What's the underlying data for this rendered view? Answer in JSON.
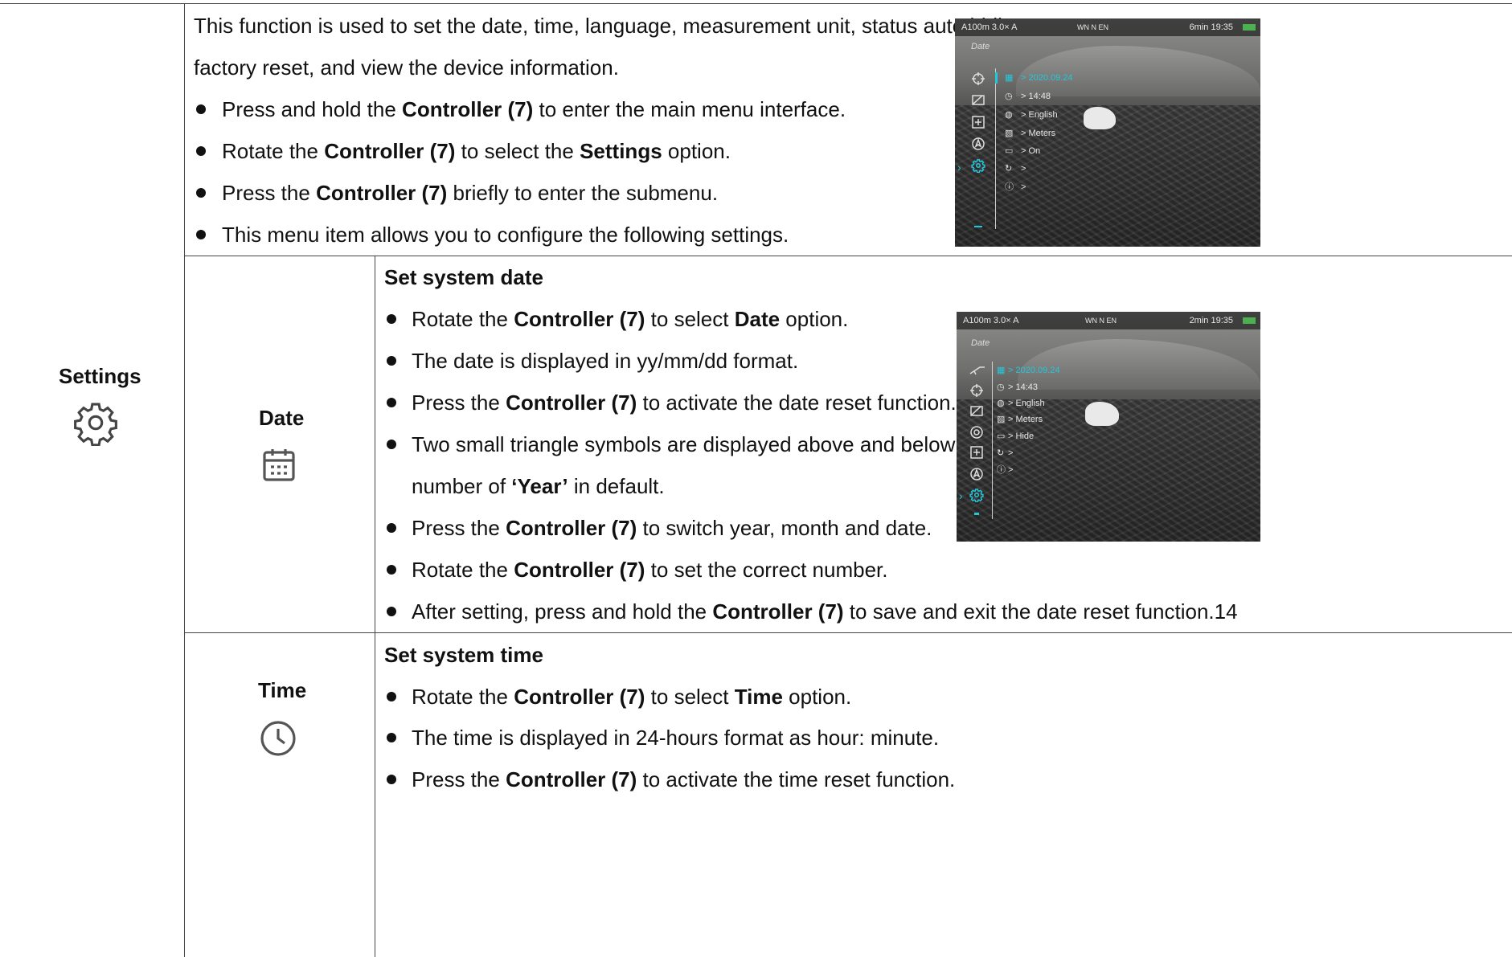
{
  "section": {
    "name": "Settings",
    "icon": "gear-icon",
    "intro": "This function is used to set the date, time, language, measurement unit, status auto hiding,",
    "intro_line2": "factory reset, and view the device information.",
    "steps": [
      {
        "pre": "Press and hold the ",
        "b1": "Controller (7)",
        "mid": " to enter the main menu interface.",
        "b2": "",
        "post": ""
      },
      {
        "pre": "Rotate the ",
        "b1": "Controller (7)",
        "mid": " to select the ",
        "b2": "Settings",
        "post": " option."
      },
      {
        "pre": "Press the ",
        "b1": "Controller (7)",
        "mid": " briefly to enter the submenu.",
        "b2": "",
        "post": ""
      },
      {
        "pre": "This menu item allows you to configure the following settings.",
        "b1": "",
        "mid": "",
        "b2": "",
        "post": ""
      }
    ]
  },
  "date": {
    "name": "Date",
    "icon": "calendar-icon",
    "heading": "Set system date",
    "steps": [
      {
        "pre": "Rotate the ",
        "b1": "Controller (7)",
        "mid": " to select ",
        "b2": "Date",
        "post": " option."
      },
      {
        "pre": "The date is displayed in yy/mm/dd format.",
        "b1": "",
        "mid": "",
        "b2": "",
        "post": ""
      },
      {
        "pre": "Press the ",
        "b1": "Controller (7)",
        "mid": " to activate the date reset function.",
        "b2": "",
        "post": ""
      },
      {
        "pre": "Two small triangle symbols are displayed above and below the",
        "b1": "",
        "mid": "",
        "b2": "",
        "post": ""
      },
      {
        "pre": "number of ",
        "b1": "‘Year’",
        "mid": " in default.",
        "b2": "",
        "post": ""
      },
      {
        "pre": "Press the ",
        "b1": "Controller (7)",
        "mid": " to switch year, month and date.",
        "b2": "",
        "post": ""
      },
      {
        "pre": "Rotate the ",
        "b1": "Controller (7)",
        "mid": " to set the correct number.",
        "b2": "",
        "post": ""
      },
      {
        "pre": "After setting, press and hold the ",
        "b1": "Controller (7)",
        "mid": " to save and exit the date reset function.14",
        "b2": "",
        "post": ""
      }
    ]
  },
  "time": {
    "name": "Time",
    "icon": "clock-icon",
    "heading": "Set system time",
    "steps": [
      {
        "pre": "Rotate the ",
        "b1": "Controller (7)",
        "mid": " to select ",
        "b2": "Time",
        "post": " option."
      },
      {
        "pre": "The time is displayed in 24-hours format as hour: minute.",
        "b1": "",
        "mid": "",
        "b2": "",
        "post": ""
      },
      {
        "pre": "Press the ",
        "b1": "Controller (7)",
        "mid": " to activate the time reset function.",
        "b2": "",
        "post": ""
      }
    ]
  },
  "screen1": {
    "status_left": "A100m   3.0×   A",
    "compass": "WN       N       EN",
    "status_right": "6min      19:35",
    "page_label": "Date",
    "items": [
      "> 2020.09.24",
      "> 14:48",
      "> English",
      "> Meters",
      "> On",
      ">",
      ">"
    ]
  },
  "screen2": {
    "status_left": "A100m   3.0×   A",
    "compass": "WN       N       EN",
    "status_right": "2min      19:35",
    "page_label": "Date",
    "items": [
      "> 2020.09.24",
      "> 14:43",
      "> English",
      "> Meters",
      "> Hide",
      ">",
      ">"
    ]
  },
  "colors": {
    "accent": "#26c6da",
    "rule": "#444444"
  }
}
